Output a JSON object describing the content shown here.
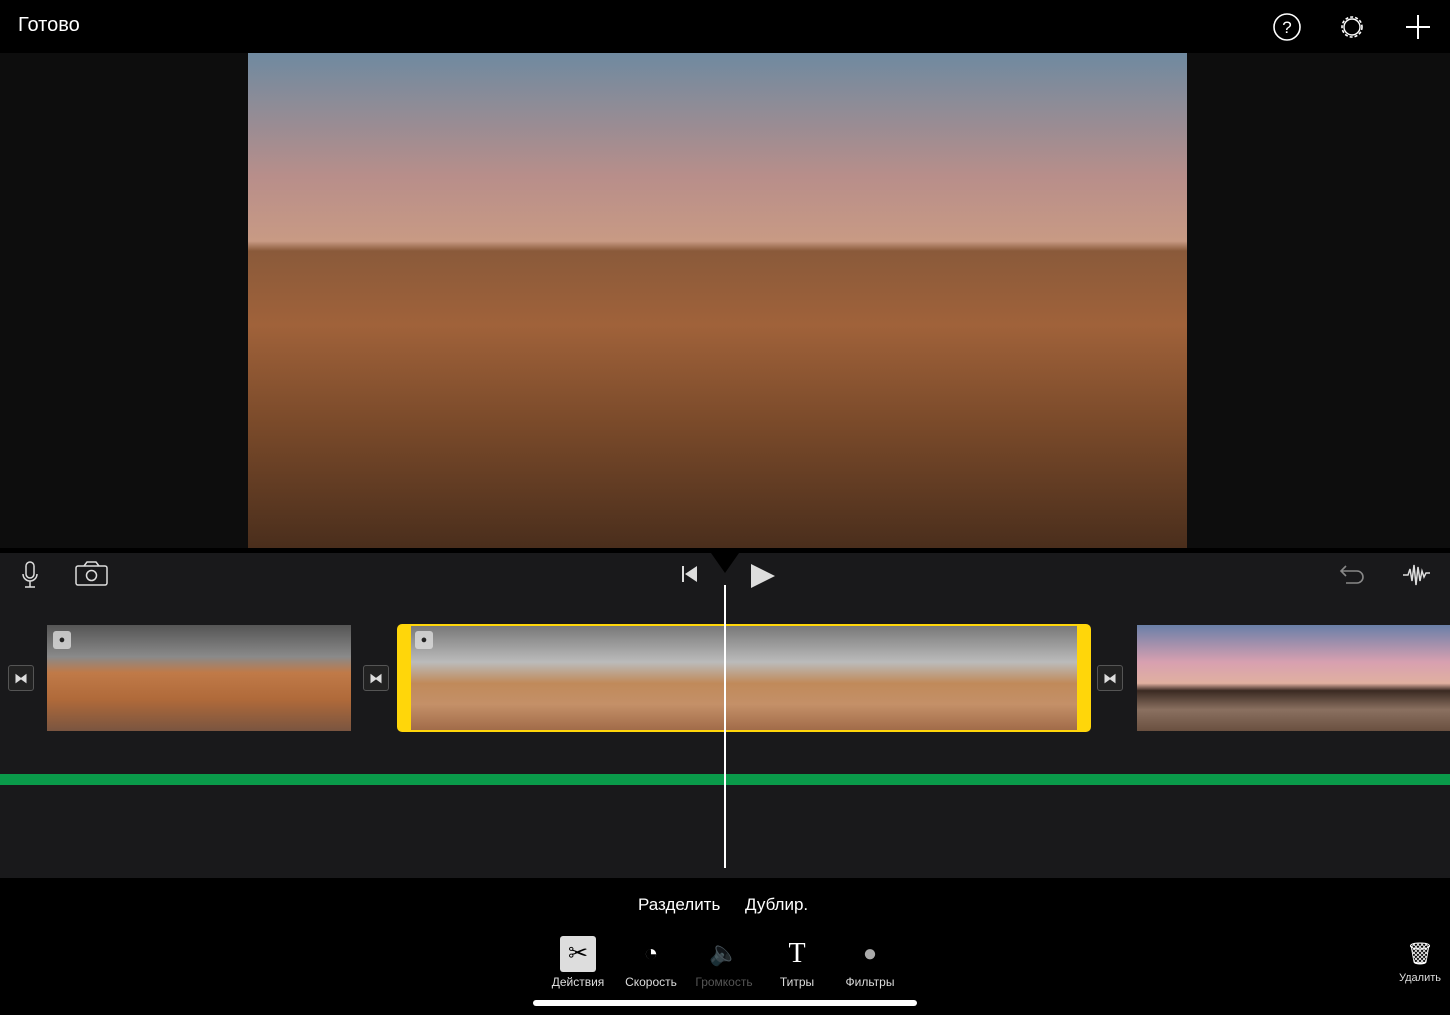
{
  "topbar": {
    "done": "Готово",
    "help_icon": "?",
    "settings_icon": "⚙",
    "add_icon": "+"
  },
  "timeline": {
    "transition_icon": "⧓",
    "clip_badge": "●"
  },
  "actions": {
    "split": "Разделить",
    "duplicate": "Дублир."
  },
  "toolbar": {
    "items": [
      {
        "label": "Действия",
        "icon": "✂"
      },
      {
        "label": "Скорость",
        "icon": "◔"
      },
      {
        "label": "Громкость",
        "icon": "🔈"
      },
      {
        "label": "Титры",
        "icon": "T"
      },
      {
        "label": "Фильтры",
        "icon": "●"
      }
    ],
    "delete": "Удалить",
    "delete_icon": "🗑"
  },
  "colors": {
    "accent": "#ffd60a",
    "audio": "#0a9a4a"
  }
}
